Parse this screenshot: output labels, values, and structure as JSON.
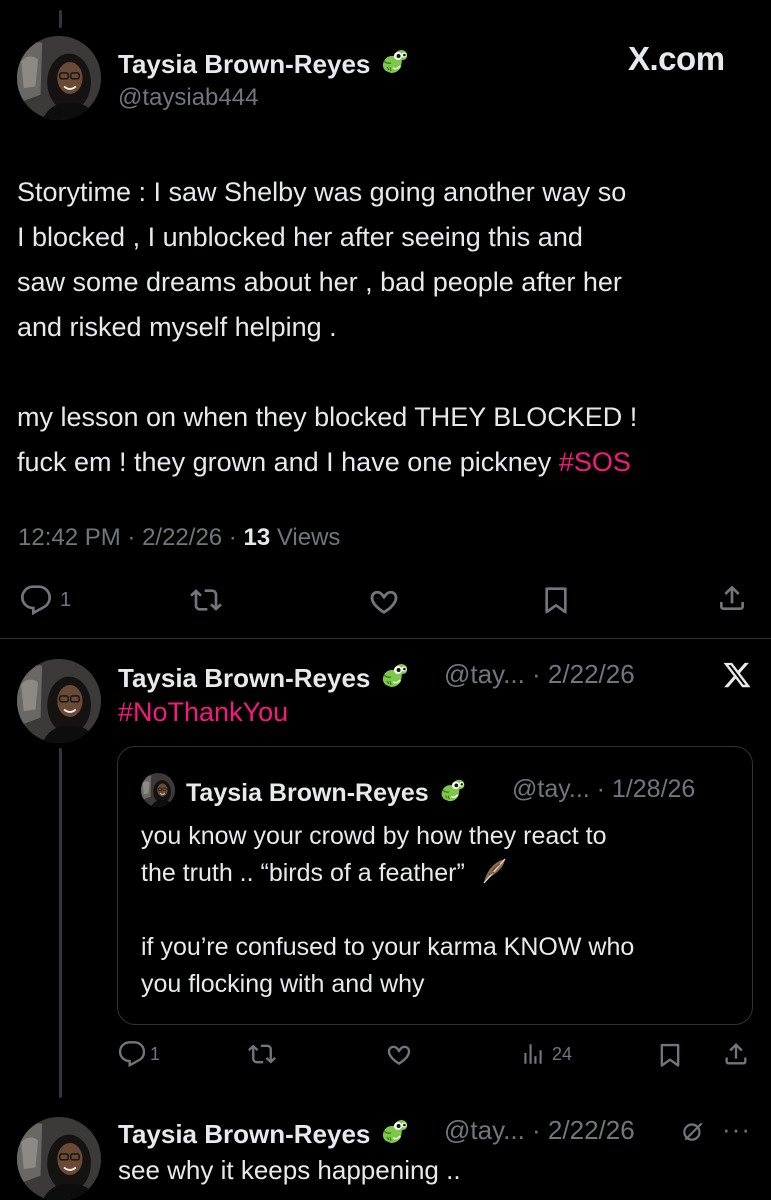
{
  "header": {
    "site_label": "X.com"
  },
  "main_post": {
    "author_name": "Taysia Brown-Reyes",
    "author_handle": "@taysiab444",
    "text_lines": [
      "Storytime : I saw Shelby was going another way so",
      "I blocked , I unblocked her after seeing this and",
      "saw some dreams about her , bad people after her",
      "and risked myself helping ."
    ],
    "text_lines_2": [
      "my lesson on when they blocked THEY BLOCKED !",
      "fuck em ! they grown and I have one pickney "
    ],
    "hashtag": "#SOS",
    "time": "12:42 PM",
    "date": "2/22/26",
    "views_count": "13",
    "views_label": "Views",
    "reply_count": "1"
  },
  "reply_post": {
    "author_name": "Taysia Brown-Reyes",
    "handle_date": "@tay... · 2/22/26",
    "hashtag": "#NoThankYou",
    "reply_count": "1",
    "views_count": "24",
    "quoted": {
      "author_name": "Taysia Brown-Reyes",
      "handle_date": "@tay... · 1/28/26",
      "line1": "you know your crowd by how they react to",
      "line2": "the truth .. “birds of a feather” ",
      "line3": "if you’re confused to your karma KNOW who",
      "line4": "you flocking with and why"
    }
  },
  "third_post": {
    "author_name": "Taysia Brown-Reyes",
    "handle_date": "@tay... · 2/22/26",
    "text": "see why it keeps happening .."
  },
  "icons": {
    "badge": "crocodile-emoji",
    "feather": "feather-emoji",
    "reply": "reply-icon",
    "repost": "repost-icon",
    "like": "like-icon",
    "bookmark": "bookmark-icon",
    "share": "share-icon",
    "views": "views-icon"
  },
  "colors": {
    "background": "#000000",
    "text": "#e7e9ea",
    "secondary": "#71767b",
    "hashtag": "#f91880",
    "border": "#2f3336"
  }
}
